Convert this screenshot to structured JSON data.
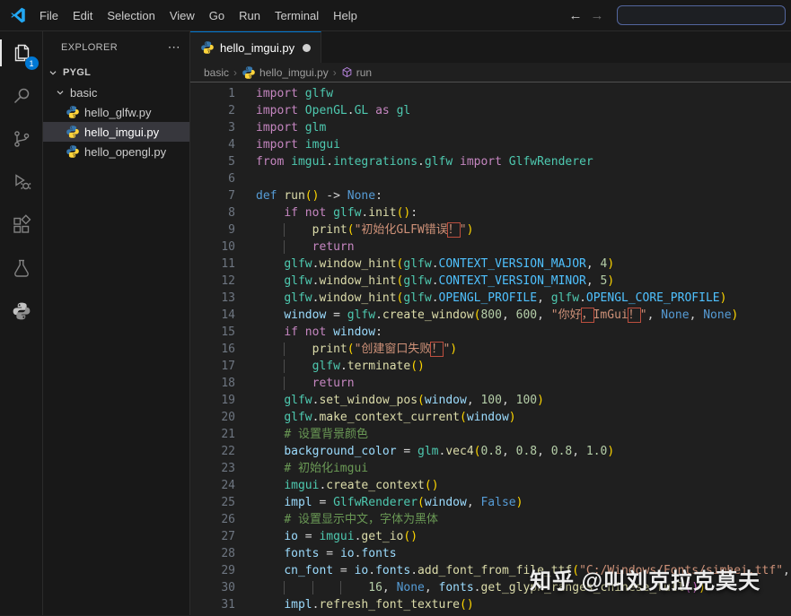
{
  "titlebar": {
    "menus": [
      "File",
      "Edit",
      "Selection",
      "View",
      "Go",
      "Run",
      "Terminal",
      "Help"
    ],
    "nav_back": "←",
    "nav_forward": "→",
    "command_center_value": ""
  },
  "activitybar": {
    "badge": "1",
    "items": [
      "explorer",
      "search",
      "source-control",
      "run-and-debug",
      "extensions",
      "testing",
      "python"
    ]
  },
  "explorer": {
    "title": "EXPLORER",
    "more_icon": "⋯",
    "root": "PYGL",
    "folder": "basic",
    "files": [
      {
        "name": "hello_glfw.py",
        "selected": false
      },
      {
        "name": "hello_imgui.py",
        "selected": true
      },
      {
        "name": "hello_opengl.py",
        "selected": false
      }
    ]
  },
  "editor": {
    "tab": {
      "name": "hello_imgui.py",
      "modified": true
    },
    "breadcrumbs": {
      "items": [
        "basic",
        "hello_imgui.py",
        "run"
      ],
      "separator": "›"
    },
    "code": [
      {
        "n": 1,
        "i": 0,
        "t": [
          [
            "import ",
            "k"
          ],
          [
            "glfw",
            "ty"
          ]
        ]
      },
      {
        "n": 2,
        "i": 0,
        "t": [
          [
            "import ",
            "k"
          ],
          [
            "OpenGL",
            "ty"
          ],
          [
            ".",
            ""
          ],
          [
            "GL",
            "ty"
          ],
          [
            " as ",
            "k"
          ],
          [
            "gl",
            "ty"
          ]
        ]
      },
      {
        "n": 3,
        "i": 0,
        "t": [
          [
            "import ",
            "k"
          ],
          [
            "glm",
            "ty"
          ]
        ]
      },
      {
        "n": 4,
        "i": 0,
        "t": [
          [
            "import ",
            "k"
          ],
          [
            "imgui",
            "ty"
          ]
        ]
      },
      {
        "n": 5,
        "i": 0,
        "t": [
          [
            "from ",
            "k"
          ],
          [
            "imgui",
            "ty"
          ],
          [
            ".",
            ""
          ],
          [
            "integrations",
            "ty"
          ],
          [
            ".",
            ""
          ],
          [
            "glfw",
            "ty"
          ],
          [
            " import ",
            "k"
          ],
          [
            "GlfwRenderer",
            "ty"
          ]
        ]
      },
      {
        "n": 6,
        "i": 0,
        "t": []
      },
      {
        "n": 7,
        "i": 0,
        "t": [
          [
            "def ",
            "kb"
          ],
          [
            "run",
            "fn"
          ],
          [
            "(",
            "b1"
          ],
          [
            ")",
            "b1"
          ],
          [
            " -> ",
            ""
          ],
          [
            "None",
            "kb"
          ],
          [
            ":",
            ""
          ]
        ]
      },
      {
        "n": 8,
        "i": 4,
        "t": [
          [
            "if ",
            "k"
          ],
          [
            "not ",
            "k"
          ],
          [
            "glfw",
            "ty"
          ],
          [
            ".",
            ""
          ],
          [
            "init",
            "fn"
          ],
          [
            "(",
            "b1"
          ],
          [
            ")",
            "b1"
          ],
          [
            ":",
            ""
          ]
        ]
      },
      {
        "n": 9,
        "i": 8,
        "t": [
          [
            "print",
            "fn"
          ],
          [
            "(",
            "b1"
          ],
          [
            "\"初始化GLFW错误",
            "s"
          ],
          [
            "！",
            "s x"
          ],
          [
            "\"",
            "s"
          ],
          [
            ")",
            "b1"
          ]
        ]
      },
      {
        "n": 10,
        "i": 8,
        "t": [
          [
            "return",
            "k"
          ]
        ]
      },
      {
        "n": 11,
        "i": 4,
        "t": [
          [
            "glfw",
            "ty"
          ],
          [
            ".",
            ""
          ],
          [
            "window_hint",
            "fn"
          ],
          [
            "(",
            "b1"
          ],
          [
            "glfw",
            "ty"
          ],
          [
            ".",
            ""
          ],
          [
            "CONTEXT_VERSION_MAJOR",
            "vc"
          ],
          [
            ", ",
            ""
          ],
          [
            "4",
            "n"
          ],
          [
            ")",
            "b1"
          ]
        ]
      },
      {
        "n": 12,
        "i": 4,
        "t": [
          [
            "glfw",
            "ty"
          ],
          [
            ".",
            ""
          ],
          [
            "window_hint",
            "fn"
          ],
          [
            "(",
            "b1"
          ],
          [
            "glfw",
            "ty"
          ],
          [
            ".",
            ""
          ],
          [
            "CONTEXT_VERSION_MINOR",
            "vc"
          ],
          [
            ", ",
            ""
          ],
          [
            "5",
            "n"
          ],
          [
            ")",
            "b1"
          ]
        ]
      },
      {
        "n": 13,
        "i": 4,
        "t": [
          [
            "glfw",
            "ty"
          ],
          [
            ".",
            ""
          ],
          [
            "window_hint",
            "fn"
          ],
          [
            "(",
            "b1"
          ],
          [
            "glfw",
            "ty"
          ],
          [
            ".",
            ""
          ],
          [
            "OPENGL_PROFILE",
            "vc"
          ],
          [
            ", ",
            ""
          ],
          [
            "glfw",
            "ty"
          ],
          [
            ".",
            ""
          ],
          [
            "OPENGL_CORE_PROFILE",
            "vc"
          ],
          [
            ")",
            "b1"
          ]
        ]
      },
      {
        "n": 14,
        "i": 4,
        "t": [
          [
            "window",
            "v"
          ],
          [
            " = ",
            ""
          ],
          [
            "glfw",
            "ty"
          ],
          [
            ".",
            ""
          ],
          [
            "create_window",
            "fn"
          ],
          [
            "(",
            "b1"
          ],
          [
            "800",
            "n"
          ],
          [
            ", ",
            ""
          ],
          [
            "600",
            "n"
          ],
          [
            ", ",
            ""
          ],
          [
            "\"你好",
            "s"
          ],
          [
            "，",
            "s x"
          ],
          [
            "ImGui",
            "s"
          ],
          [
            "！",
            "s x"
          ],
          [
            "\"",
            "s"
          ],
          [
            ", ",
            ""
          ],
          [
            "None",
            "kb"
          ],
          [
            ", ",
            ""
          ],
          [
            "None",
            "kb"
          ],
          [
            ")",
            "b1"
          ]
        ]
      },
      {
        "n": 15,
        "i": 4,
        "t": [
          [
            "if ",
            "k"
          ],
          [
            "not ",
            "k"
          ],
          [
            "window",
            "v"
          ],
          [
            ":",
            ""
          ]
        ]
      },
      {
        "n": 16,
        "i": 8,
        "t": [
          [
            "print",
            "fn"
          ],
          [
            "(",
            "b1"
          ],
          [
            "\"创建窗口失败",
            "s"
          ],
          [
            "！",
            "s x"
          ],
          [
            "\"",
            "s"
          ],
          [
            ")",
            "b1"
          ]
        ]
      },
      {
        "n": 17,
        "i": 8,
        "t": [
          [
            "glfw",
            "ty"
          ],
          [
            ".",
            ""
          ],
          [
            "terminate",
            "fn"
          ],
          [
            "(",
            "b1"
          ],
          [
            ")",
            "b1"
          ]
        ]
      },
      {
        "n": 18,
        "i": 8,
        "t": [
          [
            "return",
            "k"
          ]
        ]
      },
      {
        "n": 19,
        "i": 4,
        "t": [
          [
            "glfw",
            "ty"
          ],
          [
            ".",
            ""
          ],
          [
            "set_window_pos",
            "fn"
          ],
          [
            "(",
            "b1"
          ],
          [
            "window",
            "v"
          ],
          [
            ", ",
            ""
          ],
          [
            "100",
            "n"
          ],
          [
            ", ",
            ""
          ],
          [
            "100",
            "n"
          ],
          [
            ")",
            "b1"
          ]
        ]
      },
      {
        "n": 20,
        "i": 4,
        "t": [
          [
            "glfw",
            "ty"
          ],
          [
            ".",
            ""
          ],
          [
            "make_context_current",
            "fn"
          ],
          [
            "(",
            "b1"
          ],
          [
            "window",
            "v"
          ],
          [
            ")",
            "b1"
          ]
        ]
      },
      {
        "n": 21,
        "i": 4,
        "t": [
          [
            "# 设置背景颜色",
            "c"
          ]
        ]
      },
      {
        "n": 22,
        "i": 4,
        "t": [
          [
            "background_color",
            "v"
          ],
          [
            " = ",
            ""
          ],
          [
            "glm",
            "ty"
          ],
          [
            ".",
            ""
          ],
          [
            "vec4",
            "fn"
          ],
          [
            "(",
            "b1"
          ],
          [
            "0.8",
            "n"
          ],
          [
            ", ",
            ""
          ],
          [
            "0.8",
            "n"
          ],
          [
            ", ",
            ""
          ],
          [
            "0.8",
            "n"
          ],
          [
            ", ",
            ""
          ],
          [
            "1.0",
            "n"
          ],
          [
            ")",
            "b1"
          ]
        ]
      },
      {
        "n": 23,
        "i": 4,
        "t": [
          [
            "# 初始化imgui",
            "c"
          ]
        ]
      },
      {
        "n": 24,
        "i": 4,
        "t": [
          [
            "imgui",
            "ty"
          ],
          [
            ".",
            ""
          ],
          [
            "create_context",
            "fn"
          ],
          [
            "(",
            "b1"
          ],
          [
            ")",
            "b1"
          ]
        ]
      },
      {
        "n": 25,
        "i": 4,
        "t": [
          [
            "impl",
            "v"
          ],
          [
            " = ",
            ""
          ],
          [
            "GlfwRenderer",
            "ty"
          ],
          [
            "(",
            "b1"
          ],
          [
            "window",
            "v"
          ],
          [
            ", ",
            ""
          ],
          [
            "False",
            "kb"
          ],
          [
            ")",
            "b1"
          ]
        ]
      },
      {
        "n": 26,
        "i": 4,
        "t": [
          [
            "# 设置显示中文，字体为黑体",
            "c"
          ]
        ]
      },
      {
        "n": 27,
        "i": 4,
        "t": [
          [
            "io",
            "v"
          ],
          [
            " = ",
            ""
          ],
          [
            "imgui",
            "ty"
          ],
          [
            ".",
            ""
          ],
          [
            "get_io",
            "fn"
          ],
          [
            "(",
            "b1"
          ],
          [
            ")",
            "b1"
          ]
        ]
      },
      {
        "n": 28,
        "i": 4,
        "t": [
          [
            "fonts",
            "v"
          ],
          [
            " = ",
            ""
          ],
          [
            "io",
            "v"
          ],
          [
            ".",
            ""
          ],
          [
            "fonts",
            "v"
          ]
        ]
      },
      {
        "n": 29,
        "i": 4,
        "t": [
          [
            "cn_font",
            "v"
          ],
          [
            " = ",
            ""
          ],
          [
            "io",
            "v"
          ],
          [
            ".",
            ""
          ],
          [
            "fonts",
            "v"
          ],
          [
            ".",
            ""
          ],
          [
            "add_font_from_file_ttf",
            "fn"
          ],
          [
            "(",
            "b1"
          ],
          [
            "\"C:/Windows/Fonts/simhei.ttf\"",
            "s"
          ],
          [
            ",",
            ""
          ]
        ]
      },
      {
        "n": 30,
        "i": 16,
        "t": [
          [
            "16",
            "n"
          ],
          [
            ", ",
            ""
          ],
          [
            "None",
            "kb"
          ],
          [
            ", ",
            ""
          ],
          [
            "fonts",
            "v"
          ],
          [
            ".",
            ""
          ],
          [
            "get_glyph_ranges_chinese_full",
            "fn"
          ],
          [
            "(",
            "b2"
          ],
          [
            ")",
            "b2"
          ],
          [
            ")",
            "b1"
          ]
        ]
      },
      {
        "n": 31,
        "i": 4,
        "t": [
          [
            "impl",
            "v"
          ],
          [
            ".",
            ""
          ],
          [
            "refresh_font_texture",
            "fn"
          ],
          [
            "(",
            "b1"
          ],
          [
            ")",
            "b1"
          ]
        ]
      }
    ]
  },
  "watermark": {
    "text": "知乎 @叫刘克拉克莫夫"
  },
  "colors": {
    "accent": "#0078d4",
    "badge_bg": "#0078d4",
    "chrome_bg": "#181818",
    "editor_bg": "#1f1f1f",
    "selection_bg": "#37373d",
    "keyword": "#C586C0",
    "keyword_blue": "#569CD6",
    "type": "#4EC9B0",
    "function": "#DCDCAA",
    "variable": "#9CDCFE",
    "constant": "#4FC1FF",
    "string": "#CE9178",
    "number": "#B5CEA8",
    "comment": "#6A9955",
    "bracket_1": "#FFD700",
    "bracket_2": "#DA70D6",
    "unicode_highlight_border": "#bd4f3f"
  }
}
